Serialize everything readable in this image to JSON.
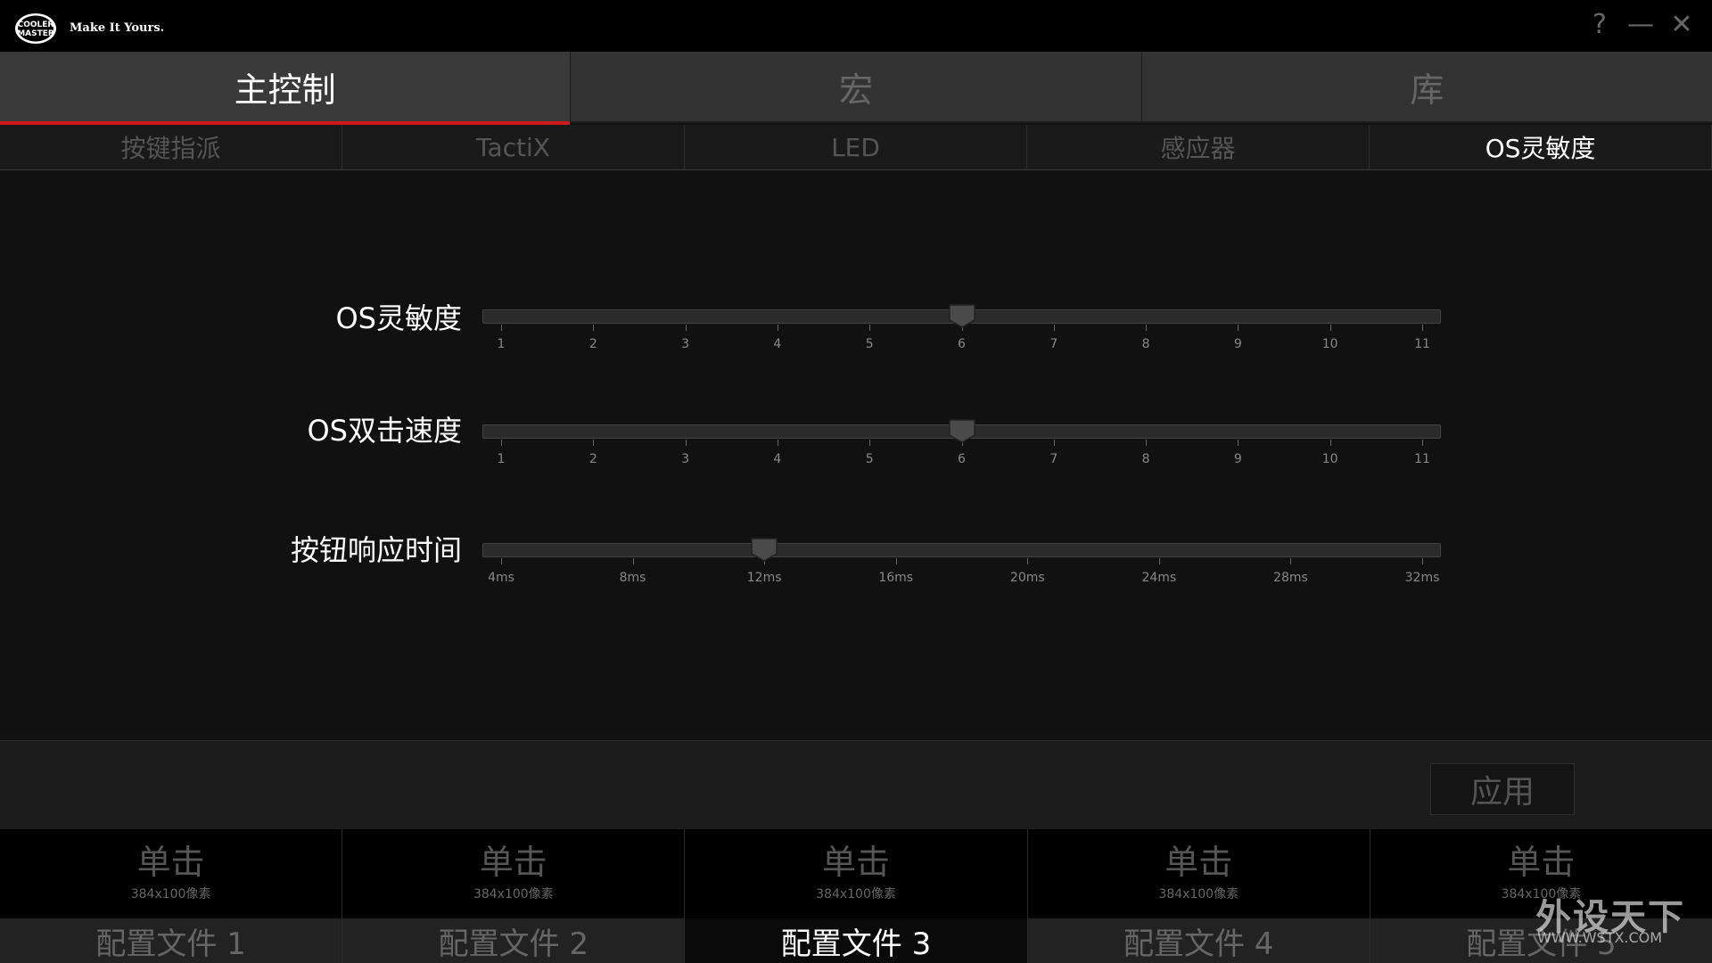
{
  "app": {
    "logo_text": "COOLER MASTER",
    "tagline": "Make It Yours.",
    "help": "?",
    "minimize": "—",
    "close": "✕"
  },
  "main_tabs": [
    "主控制",
    "宏",
    "库"
  ],
  "main_tab_active": 0,
  "sub_tabs": [
    "按键指派",
    "TactiX",
    "LED",
    "感应器",
    "OS灵敏度"
  ],
  "sub_tab_active": 4,
  "sliders": [
    {
      "label": "OS灵敏度",
      "ticks": [
        "1",
        "2",
        "3",
        "4",
        "5",
        "6",
        "7",
        "8",
        "9",
        "10",
        "11"
      ],
      "value_index": 5
    },
    {
      "label": "OS双击速度",
      "ticks": [
        "1",
        "2",
        "3",
        "4",
        "5",
        "6",
        "7",
        "8",
        "9",
        "10",
        "11"
      ],
      "value_index": 5
    },
    {
      "label": "按钮响应时间",
      "ticks": [
        "4ms",
        "8ms",
        "12ms",
        "16ms",
        "20ms",
        "24ms",
        "28ms",
        "32ms"
      ],
      "value_index": 2
    }
  ],
  "apply_label": "应用",
  "profiles": [
    {
      "title": "单击",
      "size": "384x100像素",
      "name": "配置文件 1"
    },
    {
      "title": "单击",
      "size": "384x100像素",
      "name": "配置文件 2"
    },
    {
      "title": "单击",
      "size": "384x100像素",
      "name": "配置文件 3"
    },
    {
      "title": "单击",
      "size": "384x100像素",
      "name": "配置文件 4"
    },
    {
      "title": "单击",
      "size": "384x100像素",
      "name": "配置文件 5"
    }
  ],
  "profile_active": 2,
  "watermark": {
    "text": "外设天下",
    "url": "WWW.WSTX.COM"
  },
  "colors": {
    "accent": "#d0191b",
    "bg": "#121112"
  }
}
